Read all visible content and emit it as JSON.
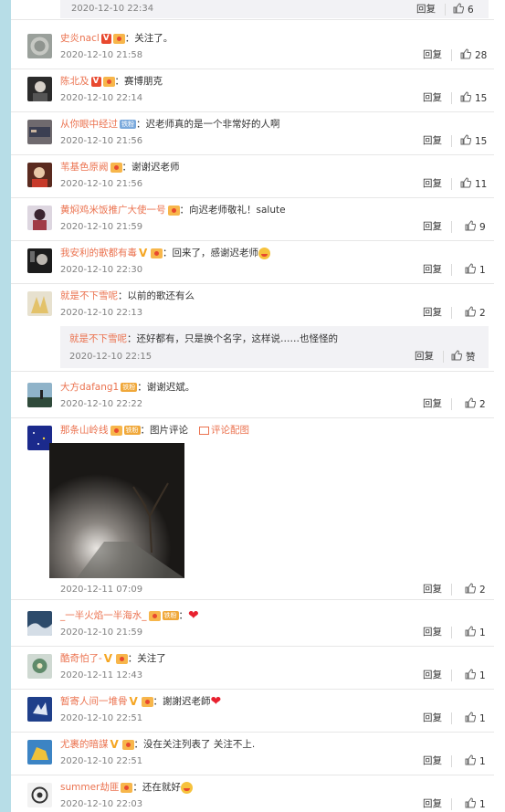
{
  "colors": {
    "username": "#eb7350",
    "text": "#333333",
    "meta": "#808080",
    "stripe": "#b7dde7",
    "nested_bg": "#f2f2f5"
  },
  "actions": {
    "reply": "回复",
    "like_icon": "thumbs-up-icon"
  },
  "top_nested": {
    "time": "2020-12-10 22:34",
    "likes": "6"
  },
  "comments": [
    {
      "user": "史炎nacl",
      "text": "：关注了。",
      "time": "2020-12-10 21:58",
      "likes": "28"
    },
    {
      "user": "陈北及",
      "text": "：赛博朋克",
      "time": "2020-12-10 22:14",
      "likes": "15"
    },
    {
      "user": "从你眼中经过",
      "badge": "铁粉",
      "text": "：迟老师真的是一个非常好的人啊",
      "time": "2020-12-10 21:56",
      "likes": "15"
    },
    {
      "user": "苇基色原阙",
      "text": "：谢谢迟老师",
      "time": "2020-12-10 21:56",
      "likes": "11"
    },
    {
      "user": "黄焖鸡米饭推广大使一号",
      "text": "：向迟老师敬礼！salute",
      "time": "2020-12-10 21:59",
      "likes": "9"
    },
    {
      "user": "我安利的歌都有毒",
      "text": "：回来了，感谢迟老师",
      "time": "2020-12-10 22:30",
      "likes": "1"
    },
    {
      "user": "就是不下雪呢",
      "text": "：以前的歌还有么",
      "time": "2020-12-10 22:13",
      "likes": "2",
      "reply": {
        "user": "就是不下雪呢",
        "text": "：还好都有，只是换个名字，这样说……也怪怪的",
        "time": "2020-12-10 22:15",
        "likes": "赞"
      }
    },
    {
      "user": "大方dafang1",
      "badge": "铁粉",
      "text": "：谢谢迟斌。",
      "time": "2020-12-10 22:22",
      "likes": "2"
    },
    {
      "user": "那条山岭线",
      "badge": "铁粉",
      "text": "：图片评论",
      "link": "评论配图",
      "time": "2020-12-11 07:09",
      "likes": "2"
    },
    {
      "user": "_一半火焰一半海水_",
      "badge": "铁粉",
      "text": "：",
      "time": "2020-12-10 21:59",
      "likes": "1"
    },
    {
      "user": "酷奇怕了-",
      "text": "：关注了",
      "time": "2020-12-11 12:43",
      "likes": "1"
    },
    {
      "user": "暂寄人间一堆骨",
      "text": "：謝謝迟老師",
      "time": "2020-12-10 22:51",
      "likes": "1"
    },
    {
      "user": "尤裹的暗謀",
      "text": "：没在关注列表了 关注不上.",
      "time": "2020-12-10 22:51",
      "likes": "1"
    },
    {
      "user": "summer劫匪",
      "text": "：还在就好",
      "time": "2020-12-10 22:03",
      "likes": "1"
    }
  ]
}
